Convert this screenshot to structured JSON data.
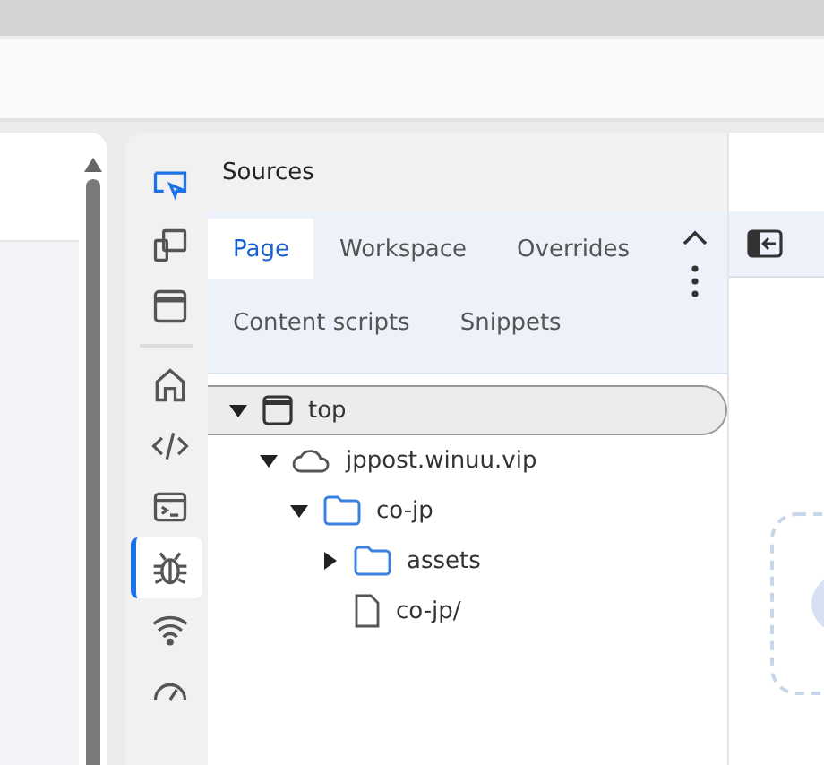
{
  "panel": {
    "title": "Sources"
  },
  "tabs": [
    {
      "label": "Page",
      "selected": true
    },
    {
      "label": "Workspace",
      "selected": false
    },
    {
      "label": "Overrides",
      "selected": false
    },
    {
      "label": "Content scripts",
      "selected": false
    },
    {
      "label": "Snippets",
      "selected": false
    }
  ],
  "rail": [
    {
      "kind": "inspect",
      "selected": false
    },
    {
      "kind": "device",
      "selected": false
    },
    {
      "kind": "window",
      "selected": false
    },
    {
      "kind": "divider"
    },
    {
      "kind": "home",
      "selected": false
    },
    {
      "kind": "code",
      "selected": false
    },
    {
      "kind": "console",
      "selected": false
    },
    {
      "kind": "bug",
      "selected": true
    },
    {
      "kind": "wifi",
      "selected": false
    },
    {
      "kind": "gauge",
      "selected": false
    }
  ],
  "tree": [
    {
      "label": "top",
      "kind": "frame",
      "expanded": true,
      "selected": true,
      "children": [
        {
          "label": "jppost.winuu.vip",
          "kind": "cloud",
          "expanded": true,
          "selected": false,
          "children": [
            {
              "label": "co-jp",
              "kind": "folder",
              "expanded": true,
              "selected": false,
              "children": [
                {
                  "label": "assets",
                  "kind": "folder",
                  "expanded": false,
                  "selected": false
                },
                {
                  "label": "co-jp/",
                  "kind": "file",
                  "selected": false
                }
              ]
            }
          ]
        }
      ]
    }
  ]
}
